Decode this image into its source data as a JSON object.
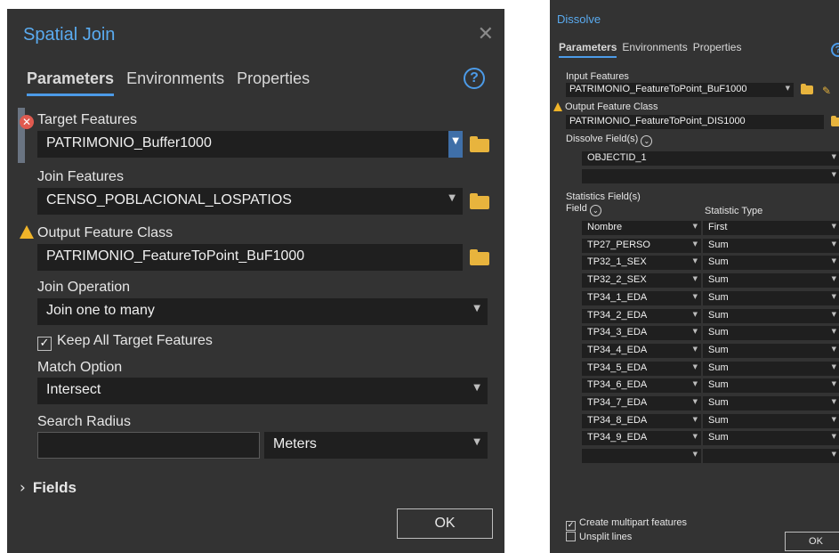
{
  "spatial_join": {
    "title": "Spatial Join",
    "close_glyph": "✕",
    "tabs": [
      "Parameters",
      "Environments",
      "Properties"
    ],
    "help_glyph": "?",
    "target_features": {
      "label": "Target Features",
      "value": "PATRIMONIO_Buffer1000"
    },
    "join_features": {
      "label": "Join Features",
      "value": "CENSO_POBLACIONAL_LOSPATIOS"
    },
    "output_feature_class": {
      "label": "Output Feature Class",
      "value": "PATRIMONIO_FeatureToPoint_BuF1000"
    },
    "join_operation": {
      "label": "Join Operation",
      "value": "Join one to many"
    },
    "keep_all": {
      "label": "Keep All Target Features",
      "checked": true
    },
    "match_option": {
      "label": "Match Option",
      "value": "Intersect"
    },
    "search_radius": {
      "label": "Search Radius",
      "value": "",
      "unit": "Meters"
    },
    "fields_label": "Fields",
    "ok_label": "OK"
  },
  "dissolve": {
    "title": "Dissolve",
    "tabs": [
      "Parameters",
      "Environments",
      "Properties"
    ],
    "help_glyph": "?",
    "input_features": {
      "label": "Input Features",
      "value": "PATRIMONIO_FeatureToPoint_BuF1000"
    },
    "output_feature_class": {
      "label": "Output Feature Class",
      "value": "PATRIMONIO_FeatureToPoint_DIS1000"
    },
    "dissolve_fields": {
      "label": "Dissolve Field(s)",
      "values": [
        "OBJECTID_1",
        ""
      ]
    },
    "statistics": {
      "label": "Statistics Field(s)",
      "field_header": "Field",
      "type_header": "Statistic Type",
      "rows": [
        {
          "field": "Nombre",
          "type": "First"
        },
        {
          "field": "TP27_PERSO",
          "type": "Sum"
        },
        {
          "field": "TP32_1_SEX",
          "type": "Sum"
        },
        {
          "field": "TP32_2_SEX",
          "type": "Sum"
        },
        {
          "field": "TP34_1_EDA",
          "type": "Sum"
        },
        {
          "field": "TP34_2_EDA",
          "type": "Sum"
        },
        {
          "field": "TP34_3_EDA",
          "type": "Sum"
        },
        {
          "field": "TP34_4_EDA",
          "type": "Sum"
        },
        {
          "field": "TP34_5_EDA",
          "type": "Sum"
        },
        {
          "field": "TP34_6_EDA",
          "type": "Sum"
        },
        {
          "field": "TP34_7_EDA",
          "type": "Sum"
        },
        {
          "field": "TP34_8_EDA",
          "type": "Sum"
        },
        {
          "field": "TP34_9_EDA",
          "type": "Sum"
        },
        {
          "field": "",
          "type": ""
        }
      ]
    },
    "create_multipart": {
      "label": "Create multipart features",
      "checked": true
    },
    "unsplit_lines": {
      "label": "Unsplit lines",
      "checked": false
    },
    "ok_label": "OK"
  },
  "colors": {
    "panel": "#333333",
    "field": "#1f1f1f",
    "accent": "#4c9be8",
    "title": "#5aabf0",
    "error": "#e05a4f",
    "warning": "#f0b429",
    "folder": "#e8b43d"
  },
  "icons": [
    "close-icon",
    "help-icon",
    "error-icon",
    "warning-icon",
    "folder-icon",
    "dropdown-arrow-icon",
    "checkbox-icon",
    "chevron-right-icon",
    "circle-chevron-down-icon",
    "pencil-icon"
  ]
}
